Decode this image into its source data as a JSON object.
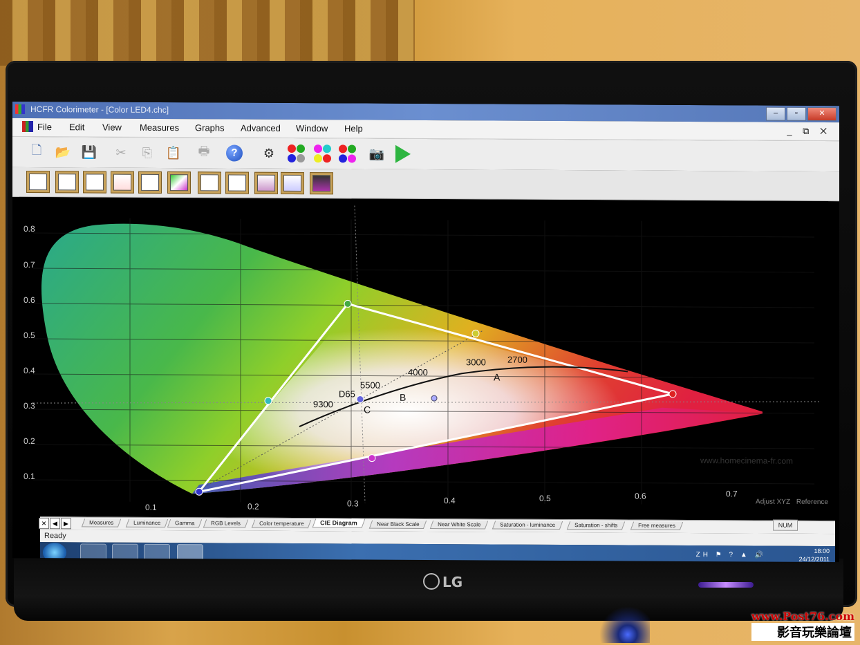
{
  "window": {
    "title": "HCFR Colorimeter - [Color LED4.chc]",
    "buttons": [
      "–",
      "▫",
      "✕"
    ]
  },
  "menu": {
    "items": [
      "File",
      "Edit",
      "View",
      "Measures",
      "Graphs",
      "Advanced",
      "Window",
      "Help"
    ],
    "mdi_buttons": "_ ⧉ ✕"
  },
  "chart": {
    "x_ticks": [
      "0.1",
      "0.2",
      "0.3",
      "0.4",
      "0.5",
      "0.6",
      "0.7"
    ],
    "y_ticks": [
      "0.1",
      "0.2",
      "0.3",
      "0.4",
      "0.5",
      "0.6",
      "0.7",
      "0.8"
    ],
    "cct_labels": [
      "9300",
      "D65",
      "5500",
      "4000",
      "3000",
      "2700"
    ],
    "point_labels": [
      "A",
      "B",
      "C"
    ],
    "credit": "www.homecinema-fr.com"
  },
  "options": {
    "adjust": "Adjust XYZ",
    "reference": "Reference"
  },
  "tabs": [
    "Measures",
    "Luminance",
    "Gamma",
    "RGB Levels",
    "Color temperature",
    "CIE Diagram",
    "Near Black Scale",
    "Near White Scale",
    "Saturation - luminance",
    "Saturation - shifts",
    "Free measures"
  ],
  "active_tab": "CIE Diagram",
  "status": {
    "text": "Ready",
    "num": "NUM"
  },
  "taskbar": {
    "time": "18:00",
    "date": "24/12/2011",
    "lang": "ZH"
  },
  "monitor": {
    "brand": "LG"
  },
  "watermark": {
    "url": "www.Post76.com",
    "name": "影音玩樂論壇"
  }
}
